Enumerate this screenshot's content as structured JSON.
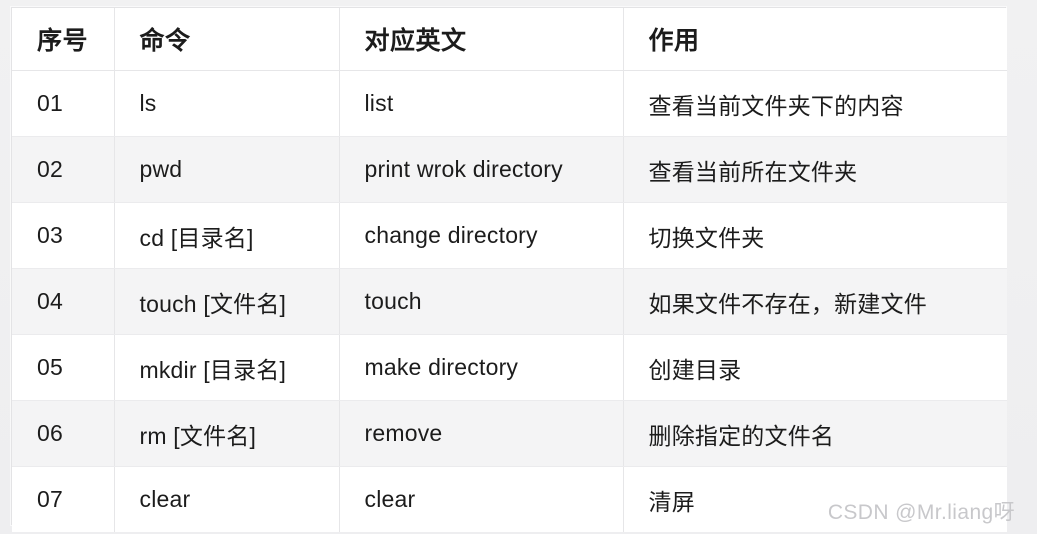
{
  "table": {
    "headers": [
      {
        "key": "seq",
        "label": "序号"
      },
      {
        "key": "command",
        "label": "命令"
      },
      {
        "key": "english",
        "label": "对应英文"
      },
      {
        "key": "usage",
        "label": "作用"
      }
    ],
    "rows": [
      {
        "seq": "01",
        "command": "ls",
        "english": "list",
        "usage": "查看当前文件夹下的内容"
      },
      {
        "seq": "02",
        "command": "pwd",
        "english": "print wrok directory",
        "usage": "查看当前所在文件夹"
      },
      {
        "seq": "03",
        "command": "cd [目录名]",
        "english": "change directory",
        "usage": "切换文件夹"
      },
      {
        "seq": "04",
        "command": "touch [文件名]",
        "english": "touch",
        "usage": "如果文件不存在，新建文件"
      },
      {
        "seq": "05",
        "command": "mkdir [目录名]",
        "english": "make directory",
        "usage": "创建目录"
      },
      {
        "seq": "06",
        "command": "rm [文件名]",
        "english": "remove",
        "usage": "删除指定的文件名"
      },
      {
        "seq": "07",
        "command": "clear",
        "english": "clear",
        "usage": "清屏"
      }
    ]
  },
  "watermark": {
    "text": "CSDN @Mr.liang呀"
  },
  "colors": {
    "page_background": "#efeff0",
    "table_background": "#ffffff",
    "row_stripe": "#f4f4f5",
    "border": "#e6e6e8",
    "text": "#1c1c1c",
    "watermark": "#c8c8cb"
  }
}
